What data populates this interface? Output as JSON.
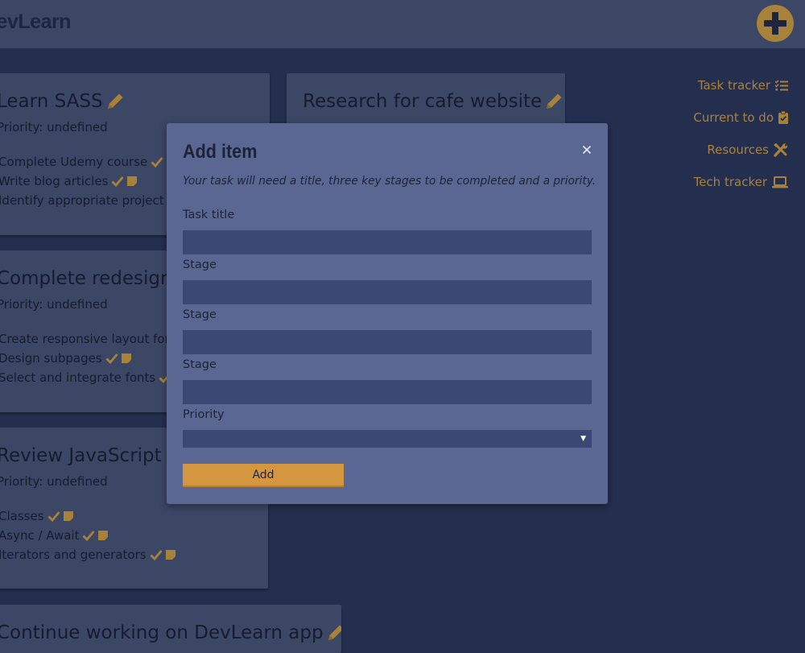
{
  "app": {
    "title": "DevLearn"
  },
  "header": {
    "add_button_icon": "plus-circle-icon"
  },
  "nav": {
    "items": [
      {
        "label": "Task tracker",
        "icon": "list-check-icon"
      },
      {
        "label": "Current to do",
        "icon": "clipboard-check-icon"
      },
      {
        "label": "Resources",
        "icon": "tools-icon"
      },
      {
        "label": "Tech tracker",
        "icon": "laptop-icon"
      }
    ]
  },
  "cards": [
    {
      "title": "Learn SASS",
      "priority": "Priority: undefined",
      "stages": [
        "Complete Udemy course",
        "Write blog articles",
        "Identify appropriate project for"
      ]
    },
    {
      "title": "Research for cafe website",
      "priority": "",
      "stages": []
    },
    {
      "title": "Complete redesign",
      "priority": "Priority: undefined",
      "stages": [
        "Create responsive layout for s",
        "Design subpages",
        "Select and integrate fonts"
      ]
    },
    {
      "title": "Review JavaScript co",
      "priority": "Priority: undefined",
      "stages": [
        "Classes",
        "Async / Await",
        "Iterators and generators"
      ]
    },
    {
      "title": "Continue working on DevLearn app",
      "priority": "",
      "stages": []
    }
  ],
  "modal": {
    "title": "Add item",
    "description": "Your task will need a title, three key stages to be completed and a priority.",
    "fields": {
      "task_title": {
        "label": "Task title",
        "value": "",
        "placeholder": ""
      },
      "stage1": {
        "label": "Stage",
        "value": "",
        "placeholder": ""
      },
      "stage2": {
        "label": "Stage",
        "value": "",
        "placeholder": ""
      },
      "stage3": {
        "label": "Stage",
        "value": "",
        "placeholder": ""
      }
    },
    "priority": {
      "label": "Priority",
      "selected": ""
    },
    "submit_label": "Add"
  },
  "colors": {
    "background": "#242f4f",
    "header": "#3c4766",
    "card": "#3c4766",
    "accent": "#a8823a",
    "modal": "#5a6792",
    "input": "#3a4874",
    "button": "#d4963f"
  }
}
